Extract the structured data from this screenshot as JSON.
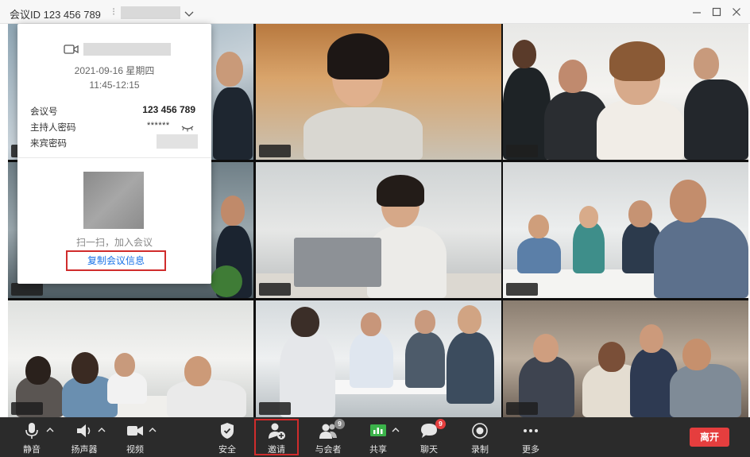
{
  "titlebar": {
    "meeting_id_label": "会议ID 123 456 789",
    "separator": "⁝"
  },
  "window_controls": [
    "minimize-icon",
    "maximize-icon",
    "close-icon"
  ],
  "info_card": {
    "date": "2021-09-16 星期四",
    "time": "11:45-12:15",
    "meeting_number_label": "会议号",
    "meeting_number_value": "123 456 789",
    "host_password_label": "主持人密码",
    "host_password_value": "******",
    "guest_password_label": "来宾密码",
    "qr_caption": "扫一扫，加入会议",
    "copy_button": "复制会议信息"
  },
  "toolbar": {
    "mute": "静音",
    "speaker": "扬声器",
    "video": "视频",
    "security": "安全",
    "invite": "邀请",
    "participants": "与会者",
    "participants_badge": "9",
    "share": "共享",
    "chat": "聊天",
    "chat_badge": "9",
    "record": "录制",
    "more": "更多",
    "leave": "离开"
  },
  "colors": {
    "toolbar_bg": "#2b2b2b",
    "leave_red": "#e53e3e",
    "highlight_red": "#d02c2c",
    "link_blue": "#1a73e8",
    "active_speaker_green": "#56c25a",
    "share_green": "#3bb34a",
    "chat_badge_red": "#e53e3e",
    "participants_badge_gray": "#888888"
  }
}
